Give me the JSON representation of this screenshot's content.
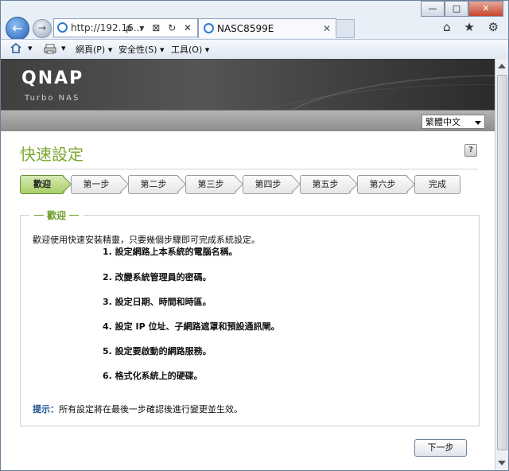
{
  "browser": {
    "address": "http://192.16...",
    "address_tools": "ρ ▾ ⊠ ↻ ✕",
    "tab_title": "NASC8599E",
    "tab_close": "✕",
    "caption": {
      "minimize": "—",
      "maximize": "□",
      "close": "✕"
    },
    "right_icons": "⌂ ★ ⚙"
  },
  "commandbar": {
    "items": [
      {
        "label": "網頁(P) ▾"
      },
      {
        "label": "安全性(S) ▾"
      },
      {
        "label": "工具(O) ▾"
      }
    ]
  },
  "header": {
    "logo": "QNAP",
    "subtitle": "Turbo NAS",
    "language": "繁體中文"
  },
  "wizard": {
    "title": "快速設定",
    "help": "?",
    "steps": [
      "歡迎",
      "第一步",
      "第二步",
      "第三步",
      "第四步",
      "第五步",
      "第六步",
      "完成"
    ],
    "section_title": "歡迎",
    "intro": "歡迎使用快速安裝精靈，只要幾個步驟即可完成系統設定。",
    "items": [
      "1. 設定網路上本系統的電腦名稱。",
      "2. 改變系統管理員的密碼。",
      "3. 設定日期、時間和時區。",
      "4. 設定 IP 位址、子網路遮罩和預設通訊閘。",
      "5. 設定要啟動的網路服務。",
      "6. 格式化系統上的硬碟。"
    ],
    "hint_label": "提示：",
    "hint_text": "所有設定將在最後一步確認後進行變更並生效。",
    "next_button": "下一步"
  }
}
